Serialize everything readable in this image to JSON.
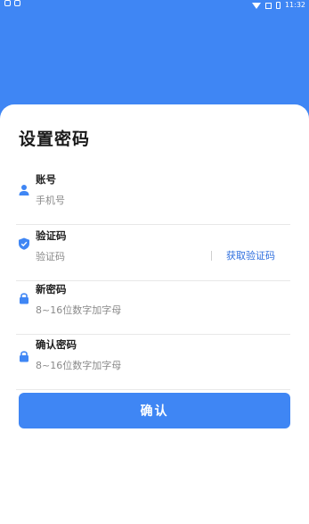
{
  "status_bar": {
    "time": "11:32",
    "icons": [
      "notification-icon",
      "app-icon",
      "wifi-icon",
      "signal-icon",
      "battery-icon"
    ]
  },
  "page": {
    "title": "设置密码"
  },
  "fields": {
    "account": {
      "label": "账号",
      "placeholder": "手机号",
      "icon": "user-icon"
    },
    "verification": {
      "label": "验证码",
      "placeholder": "验证码",
      "icon": "shield-icon",
      "action": "获取验证码"
    },
    "new_password": {
      "label": "新密码",
      "placeholder": "8~16位数字加字母",
      "icon": "lock-icon"
    },
    "confirm_password": {
      "label": "确认密码",
      "placeholder": "8~16位数字加字母",
      "icon": "lock-icon"
    }
  },
  "confirm_button": {
    "label": "确认"
  },
  "colors": {
    "primary": "#3f86f4",
    "link": "#2f6fde",
    "title": "#1a1a1a",
    "placeholder": "#8a8a8a"
  }
}
